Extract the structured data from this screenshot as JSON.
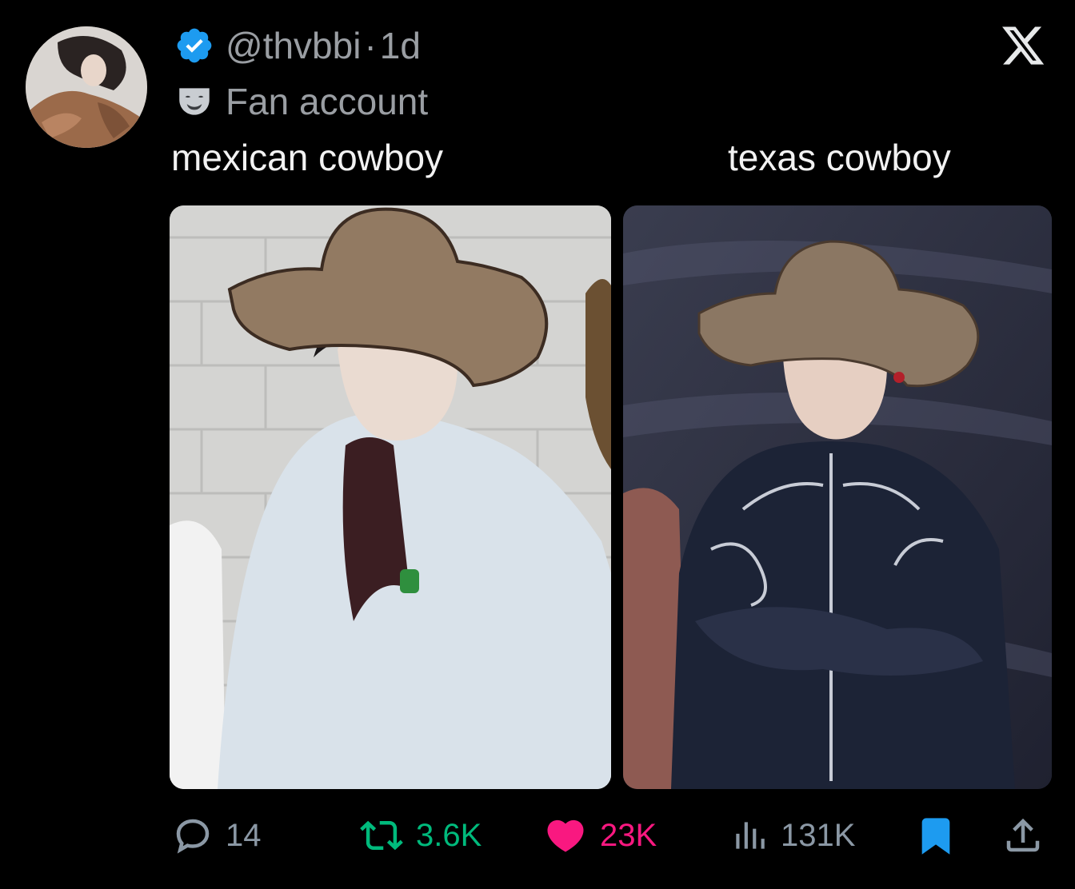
{
  "post": {
    "handle": "@thvbbi",
    "separator": "·",
    "time": "1d",
    "account_label": "Fan account",
    "verified": true
  },
  "captions": {
    "left": "mexican cowboy",
    "right": "texas cowboy"
  },
  "actions": {
    "replies": "14",
    "reposts": "3.6K",
    "likes": "23K",
    "views": "131K"
  },
  "colors": {
    "background": "#000000",
    "text": "#f2f2f2",
    "muted": "#9a9ea3",
    "verified": "#1d9bf0",
    "repost": "#00ba7c",
    "like": "#f91880",
    "bookmark": "#1d9bf0",
    "action_muted": "#8b98a5"
  },
  "icons": {
    "verified": "verified-badge-icon",
    "fan_account": "theater-mask-icon",
    "platform": "x-logo-icon",
    "reply": "reply-icon",
    "repost": "repost-icon",
    "like": "heart-icon",
    "views": "views-icon",
    "bookmark": "bookmark-icon",
    "share": "share-icon"
  }
}
